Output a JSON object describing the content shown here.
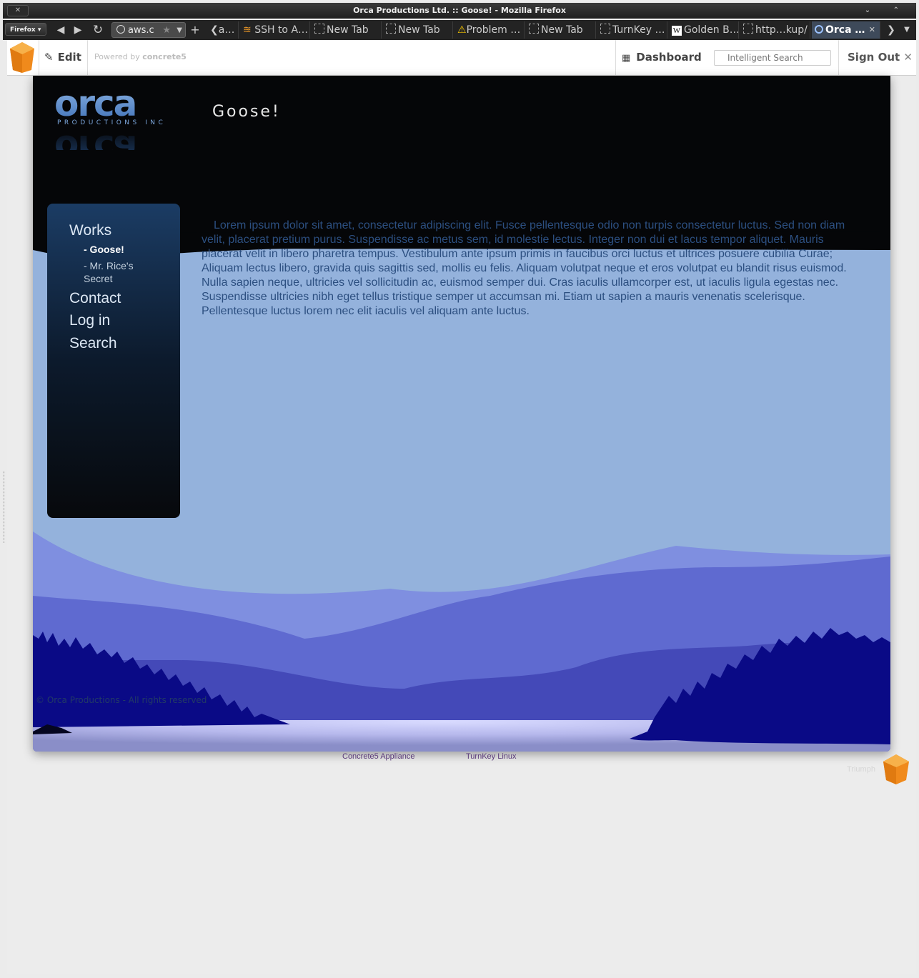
{
  "window": {
    "title": "Orca Productions Ltd. :: Goose! - Mozilla Firefox",
    "close_label": "✕",
    "controls": "⌄ ⌃"
  },
  "browser": {
    "menu_label": "Firefox ▾",
    "url": "aws.c",
    "tabs": [
      {
        "label": "SSH to A…"
      },
      {
        "label": "New Tab"
      },
      {
        "label": "New Tab"
      },
      {
        "label": "Problem …"
      },
      {
        "label": "New Tab"
      },
      {
        "label": "TurnKey …"
      },
      {
        "label": "Golden B…"
      },
      {
        "label": "http…kup/"
      },
      {
        "label": "Orca …"
      }
    ],
    "tab_prefix_label": "a…",
    "active_tab_close": "✕"
  },
  "toolbar": {
    "edit_label": "Edit",
    "powered_prefix": "Powered by ",
    "powered_brand": "concrete5",
    "dashboard_label": "Dashboard",
    "search_placeholder": "Intelligent Search",
    "signout_label": "Sign Out"
  },
  "site": {
    "logo_text": "orca",
    "logo_sub": "PRODUCTIONS INC",
    "page_title": "Goose!",
    "nav": [
      {
        "label": "Works"
      },
      {
        "label": "- Goose!"
      },
      {
        "label": "- Mr. Rice's Secret"
      },
      {
        "label": "Contact"
      },
      {
        "label": "Log in"
      },
      {
        "label": "Search"
      }
    ],
    "body": "Lorem ipsum dolor sit amet, consectetur adipiscing elit. Fusce pellentesque odio non turpis consectetur luctus. Sed non diam velit, placerat pretium purus. Suspendisse ac metus sem, id molestie lectus. Integer non dui et lacus tempor aliquet. Mauris placerat velit in libero pharetra tempus. Vestibulum ante ipsum primis in faucibus orci luctus et ultrices posuere cubilia Curae; Aliquam lectus libero, gravida quis sagittis sed, mollis eu felis. Aliquam volutpat neque et eros volutpat eu blandit risus euismod. Nulla sapien neque, ultricies vel sollicitudin ac, euismod semper dui. Cras iaculis ullamcorper est, ut iaculis ligula egestas nec. Suspendisse ultricies nibh eget tellus tristique semper ut accumsan mi. Etiam ut sapien a mauris venenatis scelerisque. Pellentesque luctus lorem nec elit iaculis vel aliquam ante luctus.",
    "copyright": "© Orca Productions - All rights reserved"
  },
  "footer": {
    "link1": "Concrete5 Appliance",
    "link2": "TurnKey Linux",
    "triumph": "Triumph"
  },
  "colors": {
    "sky": "#94b2dc",
    "mountain_far": "#7f8fe0",
    "mountain_mid": "#5f6ad0",
    "mountain_near": "#4449b8",
    "trees": "#0a0a86",
    "water_light": "#d6d8ff",
    "water_dark": "#8e94cc",
    "c5_orange": "#f08a1c"
  }
}
